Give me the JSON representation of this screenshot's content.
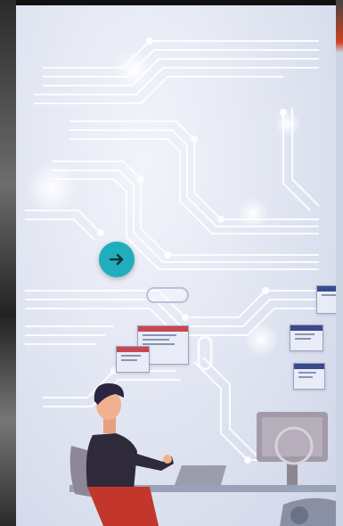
{
  "video": {
    "scene": "illustration",
    "play_control": {
      "icon": "arrow-right-icon",
      "color": "#20aebd"
    }
  },
  "colors": {
    "background": "#e3e7f3",
    "circuit": "#ffffff",
    "window_bar_red": "#c8474e",
    "window_bar_navy": "#3a4a8a",
    "shirt": "#2f2a3a",
    "pants": "#c2362c",
    "monitor": "#a39aa8"
  }
}
